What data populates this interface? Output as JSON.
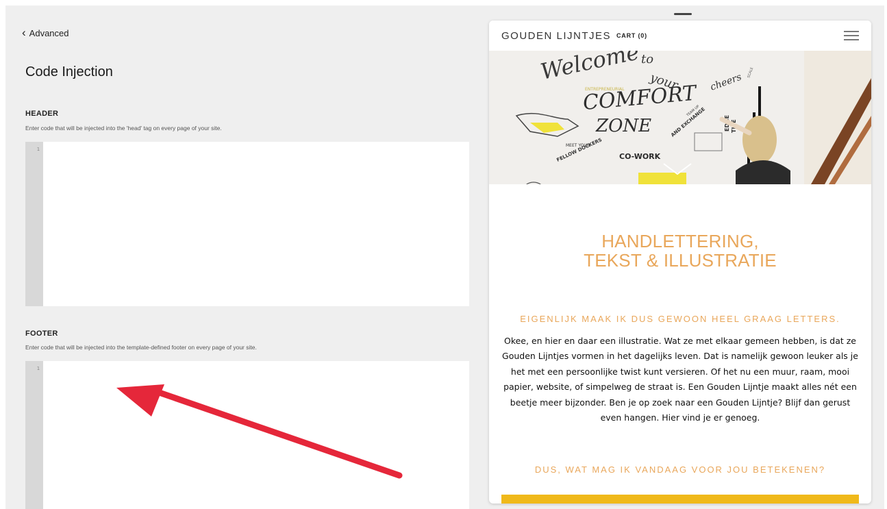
{
  "settings": {
    "back_label": "Advanced",
    "title": "Code Injection",
    "header_section": {
      "label": "HEADER",
      "description": "Enter code that will be injected into the 'head' tag on every page of your site.",
      "line_number": "1",
      "value": ""
    },
    "footer_section": {
      "label": "FOOTER",
      "description": "Enter code that will be injected into the template-defined footer on every page of your site.",
      "line_number": "1",
      "value": ""
    }
  },
  "annotation": {
    "color": "#e5273a",
    "icon": "arrow-pointing-to-footer-editor"
  },
  "preview": {
    "site_title": "GOUDEN LIJNTJES",
    "cart_label": "CART (0)",
    "menu_icon": "hamburger-menu-icon",
    "hero_image": {
      "description_icon": "hero-mural-image",
      "lettering": {
        "welcome": "Welcome",
        "to": "to",
        "your": "your",
        "entrepreneurial": "ENTREPRENEURIAL",
        "comfort": "COMFORT",
        "zone": "ZONE",
        "team_up": "TEAM UP",
        "and_exchange": "AND EXCHANGE",
        "meet_your": "MEET YOUR",
        "fellow_dockers": "FELLOW DOCKERS",
        "cowork": "CO-WORK",
        "cheers": "cheers",
        "edge": "EDGE",
        "tise": "TISE",
        "scale": "SCALE"
      }
    },
    "heading_line1": "HANDLETTERING,",
    "heading_line2": "TEKST & ILLUSTRATIE",
    "subheading": "EIGENLIJK MAAK IK DUS GEWOON HEEL GRAAG LETTERS.",
    "body": "Okee, en hier en daar een illustratie. Wat ze met elkaar gemeen hebben, is dat ze Gouden Lijntjes vormen in het dagelijks leven. Dat is namelijk gewoon leuker als je het met een persoonlijke twist kunt versieren. Of het nu een muur, raam, mooi papier, website, of simpelweg de straat is. Een Gouden Lijntje maakt alles nét een beetje meer bijzonder. Ben je op zoek naar een Gouden Lijntje? Blijf dan gerust even hangen. Hier vind je er genoeg.",
    "cta_heading": "DUS, WAT MAG IK VANDAAG VOOR JOU BETEKENEN?",
    "accent_color": "#e9a75b",
    "bar_color": "#f0b91a"
  }
}
